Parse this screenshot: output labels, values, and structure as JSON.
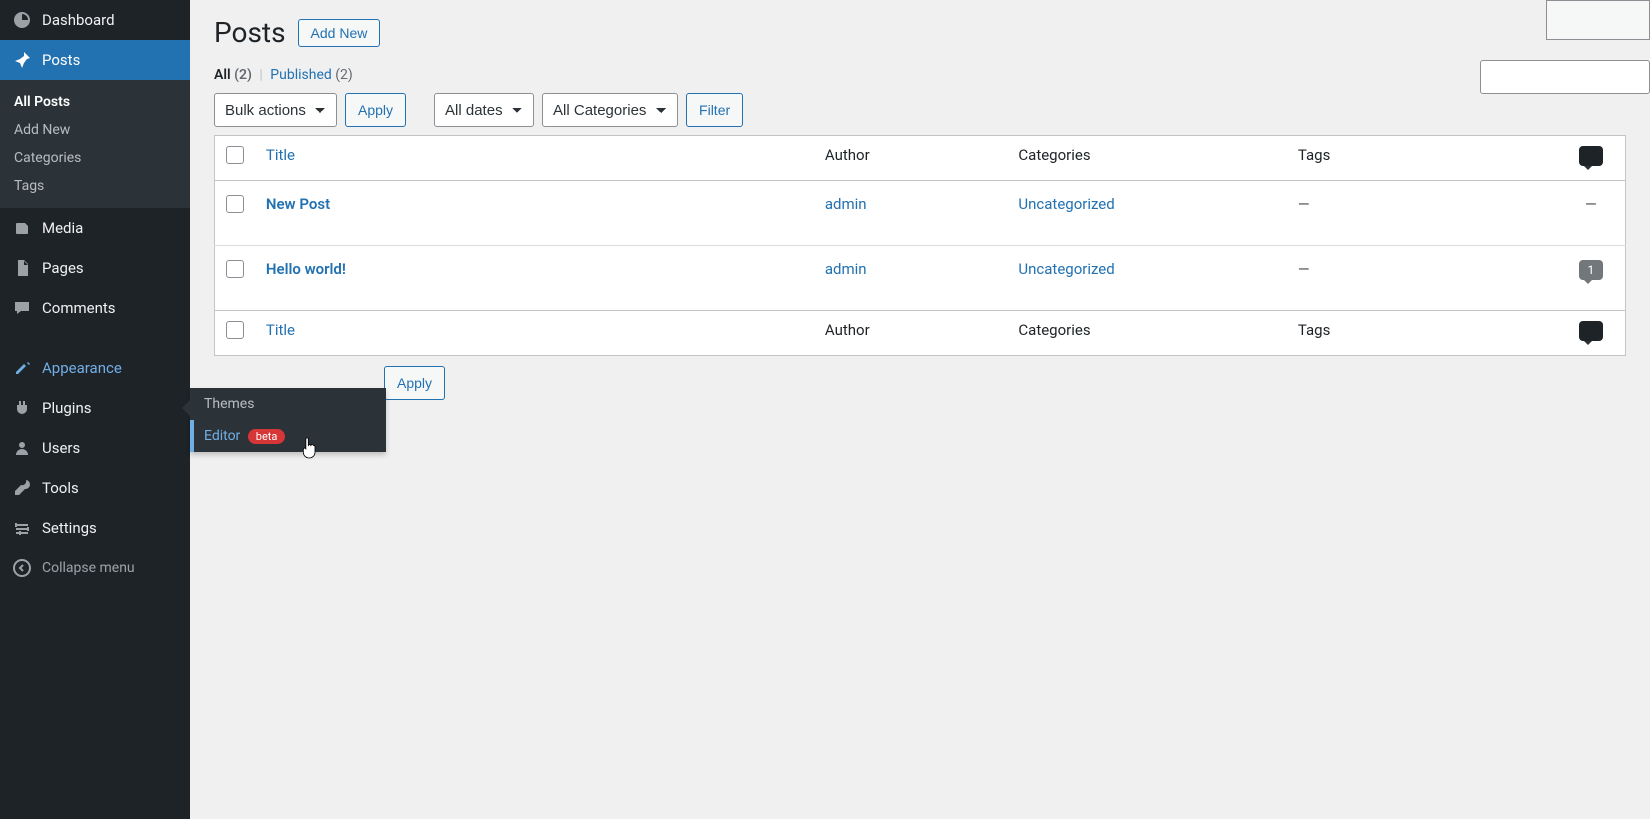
{
  "sidebar": {
    "dashboard": "Dashboard",
    "posts": "Posts",
    "posts_sub": {
      "all": "All Posts",
      "add": "Add New",
      "categories": "Categories",
      "tags": "Tags"
    },
    "media": "Media",
    "pages": "Pages",
    "comments": "Comments",
    "appearance": "Appearance",
    "plugins": "Plugins",
    "users": "Users",
    "tools": "Tools",
    "settings": "Settings",
    "collapse": "Collapse menu"
  },
  "flyout": {
    "themes": "Themes",
    "editor": "Editor",
    "beta": "beta"
  },
  "page": {
    "title": "Posts",
    "add_new": "Add New"
  },
  "views": {
    "all_label": "All",
    "all_count": "(2)",
    "published_label": "Published",
    "published_count": "(2)"
  },
  "filters": {
    "bulk": "Bulk actions",
    "apply": "Apply",
    "dates": "All dates",
    "cats": "All Categories",
    "filter": "Filter"
  },
  "columns": {
    "title": "Title",
    "author": "Author",
    "categories": "Categories",
    "tags": "Tags"
  },
  "rows": [
    {
      "title": "New Post",
      "author": "admin",
      "category": "Uncategorized",
      "tags": "—",
      "comments": "—"
    },
    {
      "title": "Hello world!",
      "author": "admin",
      "category": "Uncategorized",
      "tags": "—",
      "comments": "1"
    }
  ]
}
